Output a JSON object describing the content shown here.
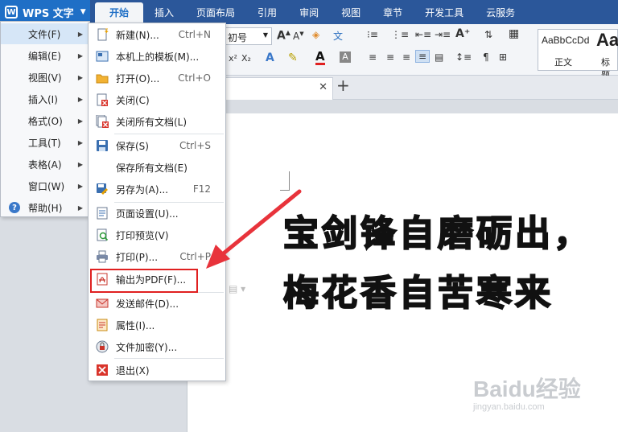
{
  "app": {
    "name": "WPS 文字",
    "logo_letter": "W"
  },
  "tabs": [
    "开始",
    "插入",
    "页面布局",
    "引用",
    "审阅",
    "视图",
    "章节",
    "开发工具",
    "云服务"
  ],
  "ribbon": {
    "font_size_value": "初号",
    "style_gallery": [
      {
        "sample": "AaBbCcDd",
        "label": "正文"
      },
      {
        "sample": "Aa",
        "label": "标题"
      }
    ]
  },
  "main_menu": [
    {
      "label": "文件(F)",
      "arrow": true
    },
    {
      "label": "编辑(E)",
      "arrow": true
    },
    {
      "label": "视图(V)",
      "arrow": true
    },
    {
      "label": "插入(I)",
      "arrow": true
    },
    {
      "label": "格式(O)",
      "arrow": true
    },
    {
      "label": "工具(T)",
      "arrow": true
    },
    {
      "label": "表格(A)",
      "arrow": true
    },
    {
      "label": "窗口(W)",
      "arrow": true
    },
    {
      "label": "帮助(H)",
      "arrow": true
    }
  ],
  "file_menu": [
    {
      "label": "新建(N)...",
      "shortcut": "Ctrl+N",
      "icon": "new-doc-icon"
    },
    {
      "label": "本机上的模板(M)...",
      "shortcut": "",
      "icon": "template-icon"
    },
    {
      "label": "打开(O)...",
      "shortcut": "Ctrl+O",
      "icon": "open-folder-icon"
    },
    {
      "label": "关闭(C)",
      "shortcut": "",
      "icon": "close-doc-icon"
    },
    {
      "label": "关闭所有文档(L)",
      "shortcut": "",
      "icon": "close-all-icon"
    },
    {
      "label": "保存(S)",
      "shortcut": "Ctrl+S",
      "icon": "save-icon"
    },
    {
      "label": "保存所有文档(E)",
      "shortcut": "",
      "icon": ""
    },
    {
      "label": "另存为(A)...",
      "shortcut": "F12",
      "icon": "save-as-icon"
    },
    {
      "label": "页面设置(U)...",
      "shortcut": "",
      "icon": "page-setup-icon"
    },
    {
      "label": "打印预览(V)",
      "shortcut": "",
      "icon": "print-preview-icon"
    },
    {
      "label": "打印(P)...",
      "shortcut": "Ctrl+P",
      "icon": "print-icon"
    },
    {
      "label": "输出为PDF(F)...",
      "shortcut": "",
      "icon": "pdf-icon"
    },
    {
      "label": "发送邮件(D)...",
      "shortcut": "",
      "icon": "mail-icon"
    },
    {
      "label": "属性(I)...",
      "shortcut": "",
      "icon": "properties-icon"
    },
    {
      "label": "文件加密(Y)...",
      "shortcut": "",
      "icon": "encrypt-icon"
    },
    {
      "label": "退出(X)",
      "shortcut": "",
      "icon": "exit-icon"
    }
  ],
  "document": {
    "lines": [
      "宝剑锋自磨砺出，",
      "梅花香自苦寒来"
    ]
  },
  "watermark": {
    "line1": "Baidu经验",
    "line2": "jingyan.baidu.com"
  },
  "colors": {
    "title_bar": "#2b579a",
    "accent": "#1f6fc6",
    "highlight_box": "#e02020"
  }
}
